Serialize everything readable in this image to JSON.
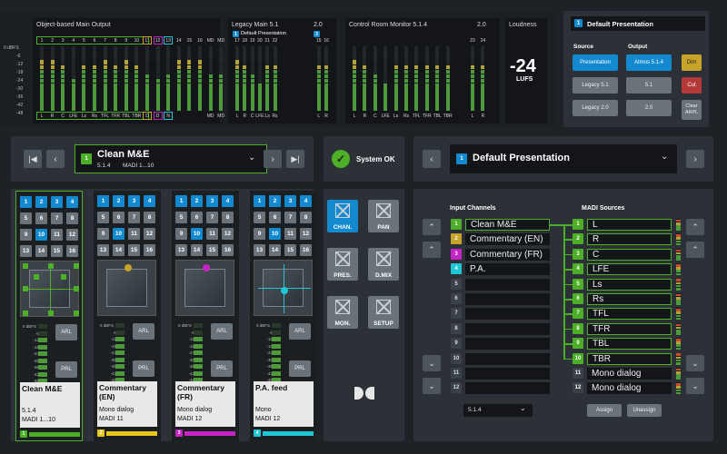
{
  "main_output": {
    "title": "Object-based Main Output",
    "scale": [
      "0 dBFS",
      "-6",
      "-12",
      "-18",
      "-24",
      "-30",
      "-36",
      "-42",
      "-48"
    ],
    "top_labels": [
      "1",
      "2",
      "3",
      "4",
      "5",
      "6",
      "7",
      "8",
      "9",
      "10",
      "11",
      "12",
      "13",
      "14",
      "15",
      "16",
      "MD",
      "MD"
    ],
    "bottom_labels": [
      "L",
      "R",
      "C",
      "LFE",
      "Ls",
      "Rs",
      "TFL",
      "TFR",
      "TBL",
      "TBR",
      "D",
      "D",
      "N",
      "",
      "",
      "",
      "MD",
      "MD"
    ]
  },
  "legacy": {
    "title": "Legacy Main 5.1",
    "version": "2.0",
    "badge": "1",
    "preset_label": "Default Presentation",
    "badge2": "3",
    "top_labels": [
      "17",
      "18",
      "19",
      "20",
      "21",
      "22",
      "15",
      "16"
    ],
    "bottom_labels": [
      "L",
      "R",
      "C",
      "LFE",
      "Ls",
      "Rs",
      "L",
      "R"
    ]
  },
  "control_room": {
    "title": "Control Room Monitor 5.1.4",
    "version": "2.0",
    "top_labels": [
      "",
      "",
      "",
      "",
      "",
      "",
      "",
      "",
      "",
      "",
      "23",
      "24"
    ],
    "bottom_labels": [
      "L",
      "R",
      "C",
      "LFE",
      "Ls",
      "Rs",
      "TFL",
      "TFR",
      "TBL",
      "TBR",
      "L",
      "R"
    ]
  },
  "loudness": {
    "title": "Loudness",
    "value": "-24",
    "unit": "LUFS"
  },
  "presentation_panel": {
    "badge": "1",
    "title": "Default Presentation",
    "source_label": "Source",
    "output_label": "Output",
    "source_buttons": [
      "Presentation",
      "Legacy 5.1",
      "Legacy 2.0"
    ],
    "output_buttons": [
      "Atmos 5.1.4",
      "5.1",
      "2.0"
    ],
    "dim": "Dim",
    "cut": "Cut",
    "clear": "Clear ARPL"
  },
  "bed_selector": {
    "badge": "1",
    "name": "Clean M&E",
    "format": "5.1.4",
    "madi": "MADI 1...10"
  },
  "status": {
    "text": "System OK"
  },
  "presentation_selector": {
    "badge": "1",
    "name": "Default Presentation"
  },
  "strips": [
    {
      "name": "Clean M&E",
      "line2": "",
      "format": "5.1.4",
      "madi": "MADI 1...10",
      "badge": "1",
      "color": "#4caf27"
    },
    {
      "name": "Commentary",
      "line2": "(EN)",
      "format": "Mono dialog",
      "madi": "MADI 11",
      "badge": "2",
      "color": "#e5c619"
    },
    {
      "name": "Commentary",
      "line2": "(FR)",
      "format": "Mono dialog",
      "madi": "MADI 12",
      "badge": "3",
      "color": "#c623c6"
    },
    {
      "name": "P.A. feed",
      "line2": "",
      "format": "Mono",
      "madi": "MADI 12",
      "badge": "4",
      "color": "#1fc6d4"
    }
  ],
  "strip_tiles": [
    "1",
    "2",
    "3",
    "4",
    "5",
    "6",
    "7",
    "8",
    "9",
    "10",
    "11",
    "12",
    "13",
    "14",
    "15",
    "16"
  ],
  "strip_scale": [
    "0 dBFS",
    "-6",
    "-12",
    "-18",
    "-24",
    "-30",
    "-36",
    "-42",
    "-48"
  ],
  "strip_buttons": {
    "arl": "ARL",
    "prl": "PRL"
  },
  "modes": [
    "CHAN.",
    "PAN",
    "PRES.",
    "D.MIX",
    "MON.",
    "SETUP"
  ],
  "routing": {
    "input_title": "Input Channels",
    "madi_title": "MADI Sources",
    "inputs": [
      {
        "n": "1",
        "label": "Clean M&E"
      },
      {
        "n": "2",
        "label": "Commentary (EN)"
      },
      {
        "n": "3",
        "label": "Commentary (FR)"
      },
      {
        "n": "4",
        "label": "P.A."
      },
      {
        "n": "5",
        "label": ""
      },
      {
        "n": "6",
        "label": ""
      },
      {
        "n": "7",
        "label": ""
      },
      {
        "n": "8",
        "label": ""
      },
      {
        "n": "9",
        "label": ""
      },
      {
        "n": "10",
        "label": ""
      },
      {
        "n": "11",
        "label": ""
      },
      {
        "n": "12",
        "label": ""
      }
    ],
    "sources": [
      {
        "n": "1",
        "label": "L"
      },
      {
        "n": "2",
        "label": "R"
      },
      {
        "n": "3",
        "label": "C"
      },
      {
        "n": "4",
        "label": "LFE"
      },
      {
        "n": "5",
        "label": "Ls"
      },
      {
        "n": "6",
        "label": "Rs"
      },
      {
        "n": "7",
        "label": "TFL"
      },
      {
        "n": "8",
        "label": "TFR"
      },
      {
        "n": "9",
        "label": "TBL"
      },
      {
        "n": "10",
        "label": "TBR"
      },
      {
        "n": "11",
        "label": "Mono dialog"
      },
      {
        "n": "12",
        "label": "Mono dialog"
      }
    ],
    "format_select": "5.1.4",
    "assign": "Assign",
    "unassign": "Unassign"
  },
  "colors": {
    "accent_blue": "#1389d0",
    "green": "#4caf27",
    "yellow": "#e5c619",
    "magenta": "#c623c6",
    "cyan": "#1fc6d4"
  }
}
